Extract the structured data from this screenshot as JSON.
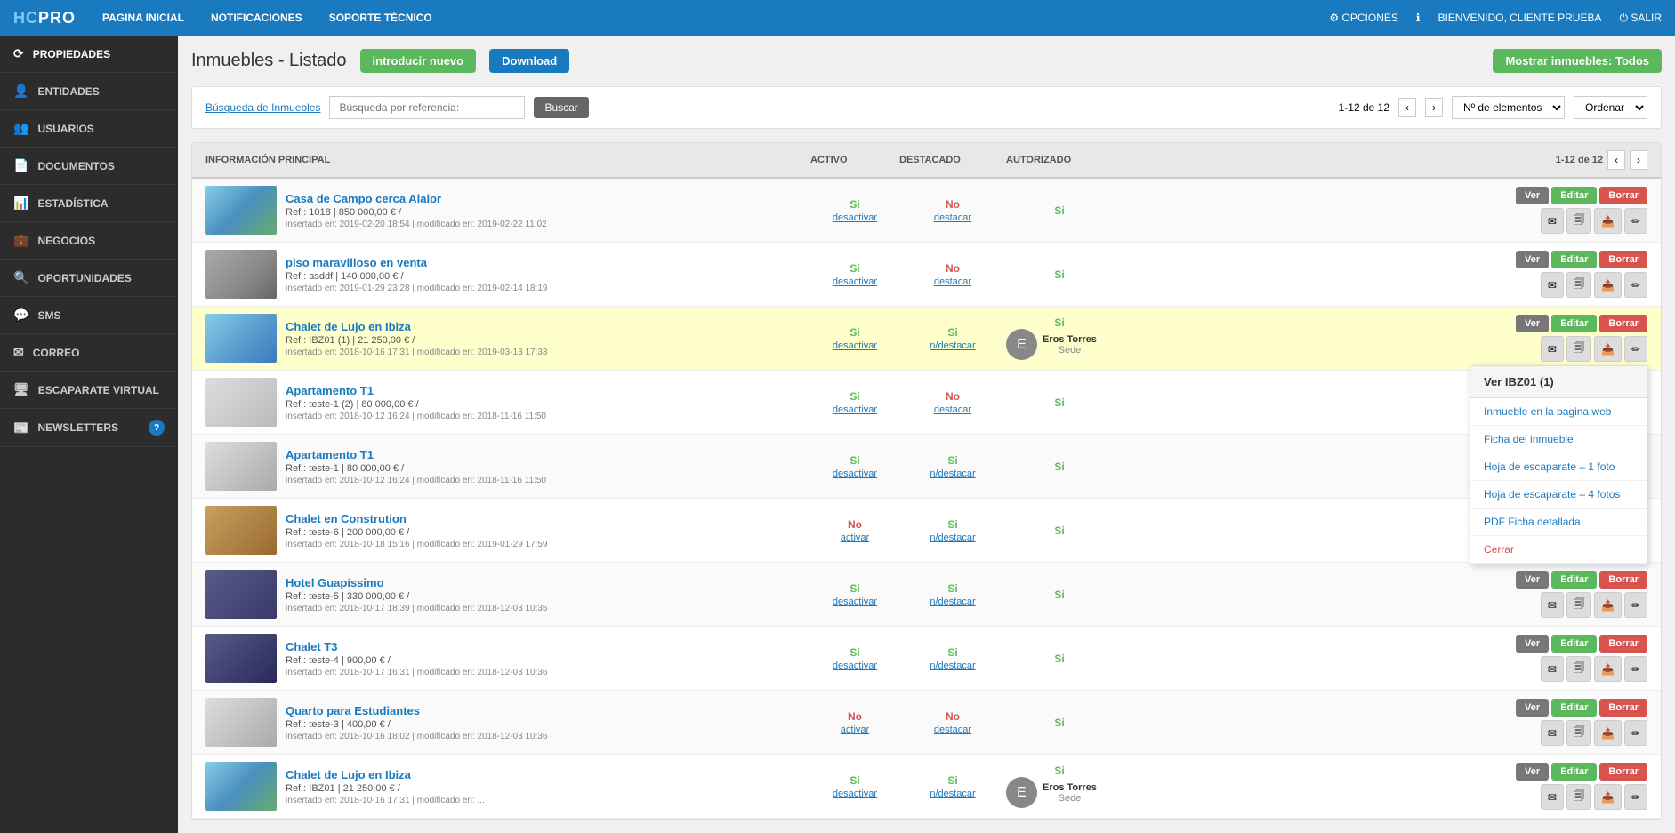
{
  "topNav": {
    "logo": "HCPRO",
    "logoHighlight": "HC",
    "links": [
      "PAGINA INICIAL",
      "NOTIFICACIONES",
      "SOPORTE TÉCNICO"
    ],
    "options": "OPCIONES",
    "welcome": "BIENVENIDO, CLIENTE PRUEBA",
    "logout": "SALIR"
  },
  "sidebar": {
    "items": [
      {
        "label": "PROPIEDADES",
        "icon": "⟳",
        "active": true
      },
      {
        "label": "ENTIDADES",
        "icon": "👤"
      },
      {
        "label": "USUARIOS",
        "icon": "👥"
      },
      {
        "label": "DOCUMENTOS",
        "icon": "📄"
      },
      {
        "label": "ESTADÍSTICA",
        "icon": "📊"
      },
      {
        "label": "NEGOCIOS",
        "icon": "💼"
      },
      {
        "label": "OPORTUNIDADES",
        "icon": "🔍"
      },
      {
        "label": "SMS",
        "icon": "💬"
      },
      {
        "label": "CORREO",
        "icon": "✉"
      },
      {
        "label": "ESCAPARATE VIRTUAL",
        "icon": "🖥"
      },
      {
        "label": "NEWSLETTERS",
        "icon": "📰",
        "badge": "?"
      }
    ]
  },
  "page": {
    "title": "Inmuebles - Listado",
    "btnNew": "introducir nuevo",
    "btnDownload": "Download",
    "btnShowAll": "Mostrar inmuebles: Todos"
  },
  "searchBar": {
    "link": "Búsqueda de Inmuebles",
    "placeholder": "Búsqueda por referencia:",
    "btnSearch": "Buscar",
    "paginationInfo": "1-12 de 12",
    "elementsLabel": "Nº de elementos",
    "orderLabel": "Ordenar"
  },
  "tableHeader": {
    "col1": "INFORMACIÓN PRINCIPAL",
    "col2": "ACTIVO",
    "col3": "DESTACADO",
    "col4": "AUTORIZADO",
    "paginationInfo": "1-12 de 12"
  },
  "properties": [
    {
      "id": 1,
      "name": "Casa de Campo cerca Alaior",
      "ref": "Ref.: 1018 | 850 000,00 € /",
      "date": "insertado en: 2019-02-20 18:54 | modificado en: 2019-02-22 11:02",
      "activo": "Si",
      "activoLink": "desactivar",
      "destacado": "No",
      "destacadoLink": "destacar",
      "autorizado": "Si",
      "thumbClass": "thumb-1",
      "agent": null,
      "highlighted": false
    },
    {
      "id": 2,
      "name": "piso maravilloso en venta",
      "ref": "Ref.: asddf | 140 000,00 € /",
      "date": "insertado en: 2019-01-29 23:28 | modificado en: 2019-02-14 18:19",
      "activo": "Si",
      "activoLink": "desactivar",
      "destacado": "No",
      "destacadoLink": "destacar",
      "autorizado": "Si",
      "thumbClass": "thumb-2",
      "agent": null,
      "highlighted": false
    },
    {
      "id": 3,
      "name": "Chalet de Lujo en Ibiza",
      "ref": "Ref.: IBZ01 (1) | 21 250,00 € /",
      "date": "insertado en: 2018-10-16 17:31 | modificado en: 2019-03-13 17:33",
      "activo": "Si",
      "activoLink": "desactivar",
      "destacado": "Si",
      "destacadoLink": "n/destacar",
      "autorizado": "Si",
      "thumbClass": "thumb-3",
      "agent": {
        "name": "Eros Torres",
        "role": "Sede",
        "initials": "E"
      },
      "highlighted": true
    },
    {
      "id": 4,
      "name": "Apartamento T1",
      "ref": "Ref.: teste-1 (2) | 80 000,00 € /",
      "date": "insertado en: 2018-10-12 16:24 | modificado en: 2018-11-16 11:50",
      "activo": "Si",
      "activoLink": "desactivar",
      "destacado": "No",
      "destacadoLink": "destacar",
      "autorizado": "Si",
      "thumbClass": "thumb-4",
      "agent": null,
      "highlighted": false
    },
    {
      "id": 5,
      "name": "Apartamento T1",
      "ref": "Ref.: teste-1 | 80 000,00 € /",
      "date": "insertado en: 2018-10-12 16:24 | modificado en: 2018-11-16 11:50",
      "activo": "Si",
      "activoLink": "desactivar",
      "destacado": "Si",
      "destacadoLink": "n/destacar",
      "autorizado": "Si",
      "thumbClass": "thumb-5",
      "agent": null,
      "highlighted": false
    },
    {
      "id": 6,
      "name": "Chalet en Constrution",
      "ref": "Ref.: teste-6 | 200 000,00 € /",
      "date": "insertado en: 2018-10-18 15:16 | modificado en: 2019-01-29 17:59",
      "activo": "No",
      "activoLink": "activar",
      "destacado": "Si",
      "destacadoLink": "n/destacar",
      "autorizado": "Si",
      "thumbClass": "thumb-6",
      "agent": null,
      "highlighted": false,
      "hasBadge": true
    },
    {
      "id": 7,
      "name": "Hotel Guapíssimo",
      "ref": "Ref.: teste-5 | 330 000,00 € /",
      "date": "insertado en: 2018-10-17 18:39 | modificado en: 2018-12-03 10:35",
      "activo": "Si",
      "activoLink": "desactivar",
      "destacado": "Si",
      "destacadoLink": "n/destacar",
      "autorizado": "Si",
      "thumbClass": "thumb-7",
      "agent": null,
      "highlighted": false
    },
    {
      "id": 8,
      "name": "Chalet T3",
      "ref": "Ref.: teste-4 | 900,00 € /",
      "date": "insertado en: 2018-10-17 16:31 | modificado en: 2018-12-03 10:36",
      "activo": "Si",
      "activoLink": "desactivar",
      "destacado": "Si",
      "destacadoLink": "n/destacar",
      "autorizado": "Si",
      "thumbClass": "thumb-8",
      "agent": null,
      "highlighted": false
    },
    {
      "id": 9,
      "name": "Quarto para Estudiantes",
      "ref": "Ref.: teste-3 | 400,00 € /",
      "date": "insertado en: 2018-10-16 18:02 | modificado en: 2018-12-03 10:36",
      "activo": "No",
      "activoLink": "activar",
      "destacado": "No",
      "destacadoLink": "destacar",
      "autorizado": "Si",
      "thumbClass": "thumb-9",
      "agent": null,
      "highlighted": false
    },
    {
      "id": 10,
      "name": "Chalet de Lujo en Ibiza",
      "ref": "Ref.: IBZ01 | 21 250,00 € /",
      "date": "insertado en: 2018-10-16 17:31 | modificado en: ...",
      "activo": "Si",
      "activoLink": "desactivar",
      "destacado": "Si",
      "destacadoLink": "n/destacar",
      "autorizado": "Si",
      "thumbClass": "thumb-10",
      "agent": {
        "name": "Eros Torres",
        "role": "Sede",
        "initials": "E"
      },
      "highlighted": false
    }
  ],
  "dropdown": {
    "header": "Ver IBZ01 (1)",
    "items": [
      {
        "label": "Inmueble en la pagina web",
        "type": "link"
      },
      {
        "label": "Ficha del inmueble",
        "type": "link"
      },
      {
        "label": "Hoja de escaparate – 1 foto",
        "type": "link"
      },
      {
        "label": "Hoja de escaparate – 4 fotos",
        "type": "link"
      },
      {
        "label": "PDF Ficha detallada",
        "type": "link"
      },
      {
        "label": "Cerrar",
        "type": "close"
      }
    ]
  },
  "buttons": {
    "ver": "Ver",
    "editar": "Editar",
    "borrar": "Borrar"
  }
}
